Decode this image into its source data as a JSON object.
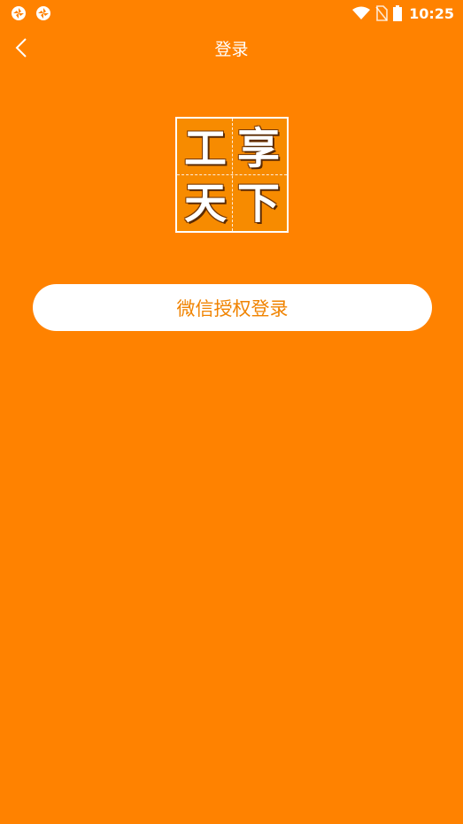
{
  "status_bar": {
    "time": "10:25",
    "left_icons": [
      "notification-app-icon",
      "notification-app-icon"
    ],
    "right_icons": [
      "wifi-icon",
      "no-sim-icon",
      "battery-icon"
    ]
  },
  "nav": {
    "back_icon": "chevron-left-icon",
    "title": "登录"
  },
  "logo": {
    "chars": [
      "工",
      "享",
      "天",
      "下"
    ]
  },
  "login_button": {
    "label": "微信授权登录"
  },
  "colors": {
    "background": "#FF8200",
    "button_background": "#FFFFFF",
    "button_text": "#F08300",
    "title_text": "#FFFFFF"
  }
}
